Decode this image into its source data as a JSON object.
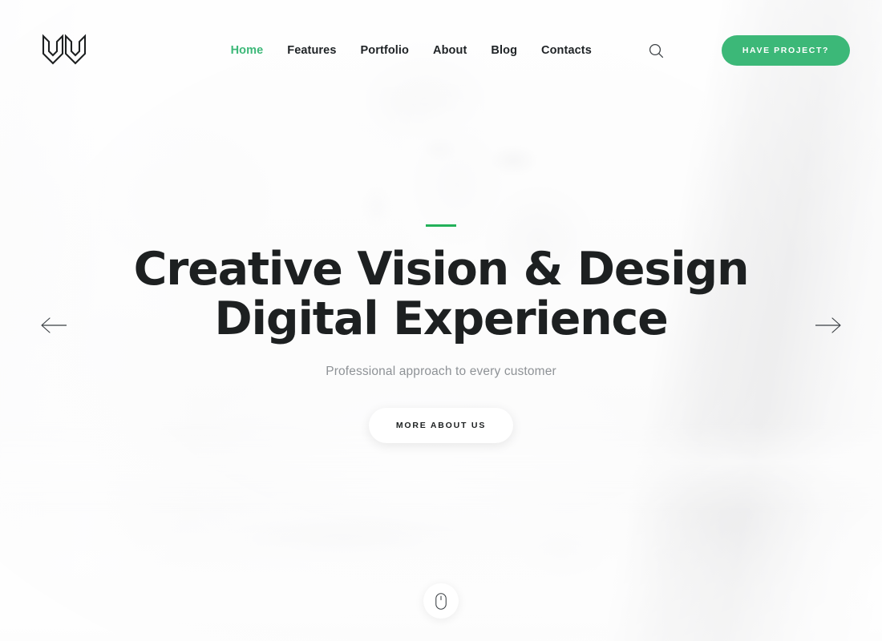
{
  "header": {
    "logo_name": "brand-logo",
    "nav": [
      {
        "label": "Home",
        "active": true
      },
      {
        "label": "Features",
        "active": false
      },
      {
        "label": "Portfolio",
        "active": false
      },
      {
        "label": "About",
        "active": false
      },
      {
        "label": "Blog",
        "active": false
      },
      {
        "label": "Contacts",
        "active": false
      }
    ],
    "search_icon": "search-icon",
    "cta_label": "HAVE PROJECT?"
  },
  "hero": {
    "headline_line1": "Creative Vision & Design",
    "headline_line2": "Digital Experience",
    "subtitle": "Professional approach to every customer",
    "button_label": "MORE ABOUT US",
    "prev_icon": "arrow-left-icon",
    "next_icon": "arrow-right-icon",
    "scroll_icon": "mouse-scroll-icon"
  },
  "colors": {
    "accent_green": "#3cb878",
    "divider_green": "#23b159",
    "headline": "#1d2021",
    "subtitle": "#8e9296",
    "nav_text": "#1f2326",
    "background": "#fbfbfb"
  }
}
